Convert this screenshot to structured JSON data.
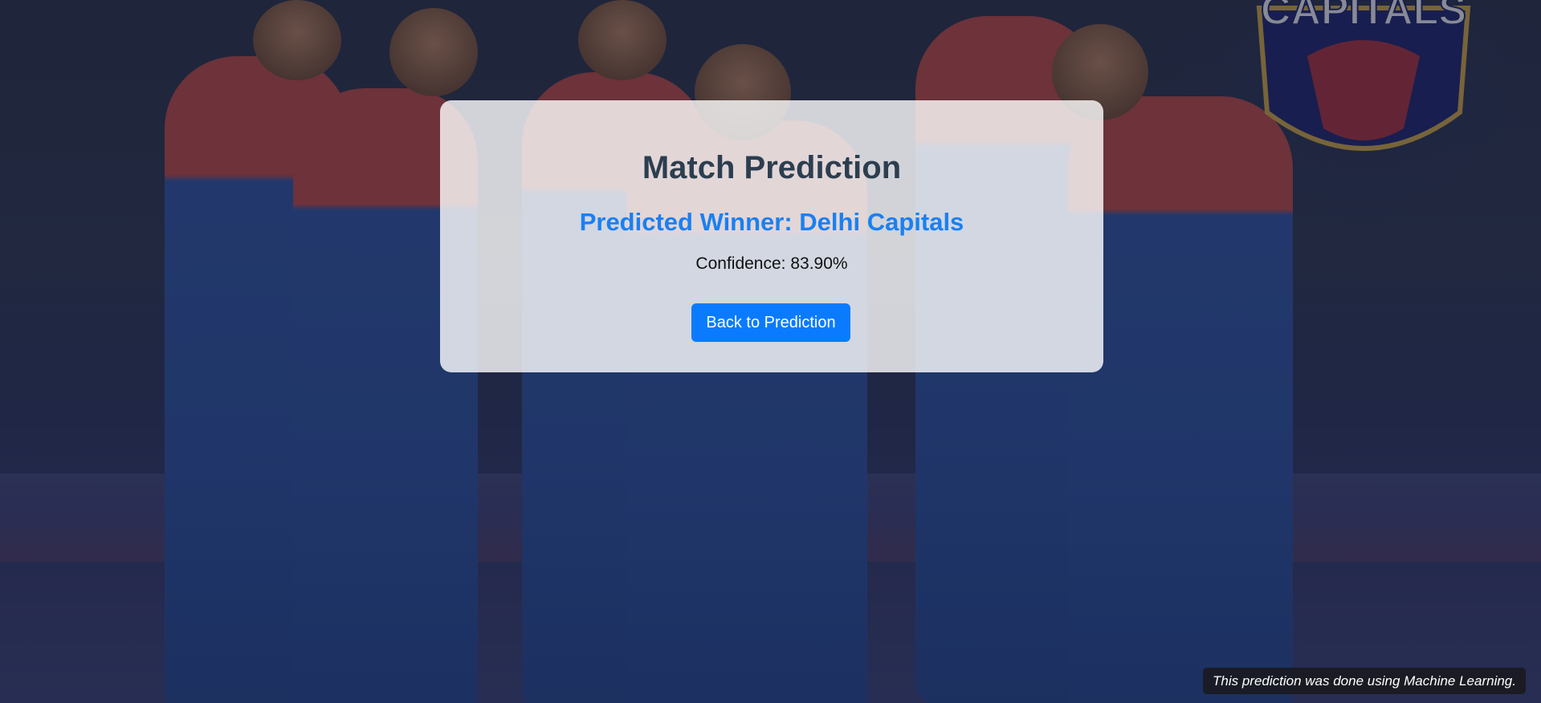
{
  "background": {
    "logo_text": "CAPITALS"
  },
  "card": {
    "title": "Match Prediction",
    "winner_text": "Predicted Winner: Delhi Capitals",
    "confidence_text": "Confidence: 83.90%",
    "back_button_label": "Back to Prediction"
  },
  "footer": {
    "note": "This prediction was done using Machine Learning."
  },
  "colors": {
    "title": "#2c3e50",
    "winner": "#1a80f2",
    "button": "#0a7bff"
  }
}
